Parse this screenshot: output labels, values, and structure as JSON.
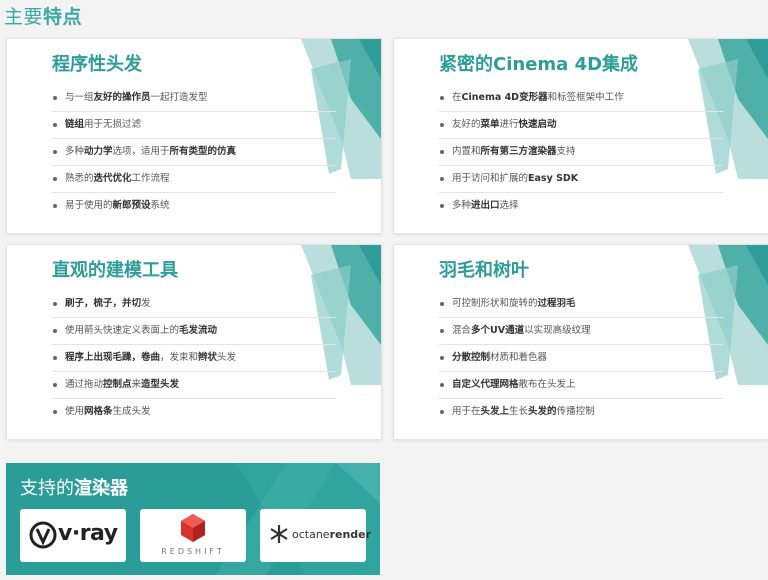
{
  "page": {
    "title_light": "主要",
    "title_bold": "特点"
  },
  "colors": {
    "accent": "#2e9d98",
    "panel": "#2b9d98"
  },
  "cards": [
    {
      "title": "程序性头发",
      "items": [
        [
          "与一组",
          "友好的操作员",
          "一起打造发型"
        ],
        [
          "",
          "链组",
          "用于无损过滤"
        ],
        [
          "多种",
          "动力学",
          "选项，适用于",
          "所有类型的仿真",
          ""
        ],
        [
          "熟悉的",
          "迭代优化",
          "工作流程"
        ],
        [
          "易于使用的",
          "新郎预设",
          "系统"
        ]
      ]
    },
    {
      "title": "紧密的Cinema 4D集成",
      "items": [
        [
          "在",
          "Cinema 4D变形器",
          "和标签框架中工作"
        ],
        [
          "友好的",
          "菜单",
          "进行",
          "快速启动",
          ""
        ],
        [
          "内置和",
          "所有第三方渲染器",
          "支持"
        ],
        [
          "用于访问和扩展的",
          "Easy SDK",
          ""
        ],
        [
          "多种",
          "进出口",
          "选择"
        ]
      ]
    },
    {
      "title": "直观的建模工具",
      "items": [
        [
          "",
          "刷子，梳子，并切",
          "发"
        ],
        [
          "使用箭头快速定义表面上的",
          "毛发流动",
          ""
        ],
        [
          "",
          "程序上出现毛躁，卷曲",
          "，发束和",
          "辫状",
          "头发"
        ],
        [
          "通过拖动",
          "控制点",
          "来",
          "造型头发",
          ""
        ],
        [
          "使用",
          "网格条",
          "生成头发"
        ]
      ]
    },
    {
      "title": "羽毛和树叶",
      "items": [
        [
          "可控制形状和旋转的",
          "过程羽毛",
          ""
        ],
        [
          "混合",
          "多个UV通道",
          "以实现高级纹理"
        ],
        [
          "",
          "分散控制",
          "材质和着色器"
        ],
        [
          "",
          "自定义代理网格",
          "散布在头发上"
        ],
        [
          "用于在",
          "头发上",
          "生长",
          "头发的",
          "传播控制"
        ]
      ]
    }
  ],
  "renderers": {
    "title_light": "支持的",
    "title_bold": "渲染器",
    "logos": [
      {
        "name": "V-Ray",
        "text": "v·ray"
      },
      {
        "name": "Redshift",
        "text": "REDSHIFT"
      },
      {
        "name": "Octane",
        "text_light": "octane",
        "text_bold": "render"
      }
    ]
  }
}
